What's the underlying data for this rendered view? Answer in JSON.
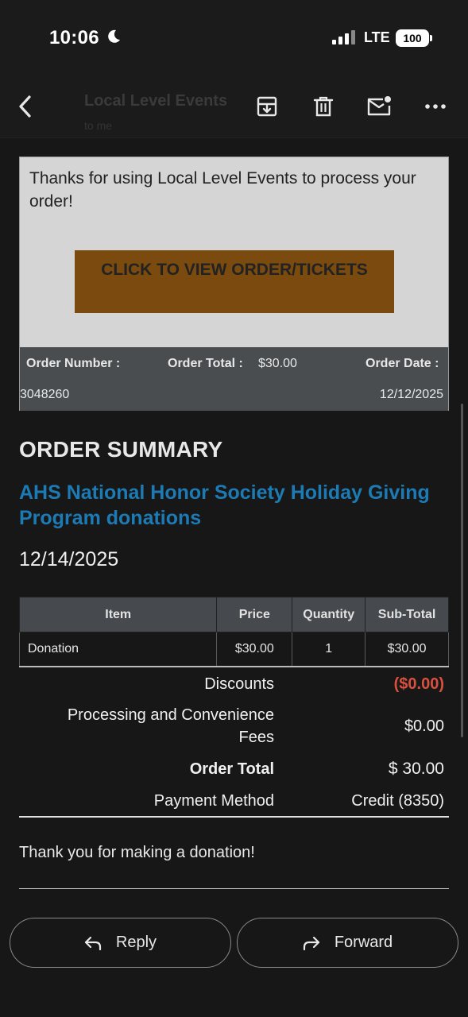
{
  "status_bar": {
    "time": "10:06",
    "network": "LTE",
    "battery": "100"
  },
  "toolbar": {
    "sender_faded": "Local Level Events",
    "recipient_faded": "to me"
  },
  "email": {
    "intro": "Thanks for using Local Level Events to process your order!",
    "cta_label": "CLICK TO VIEW ORDER/TICKETS",
    "order_number_label": "Order Number :",
    "order_number": "3048260",
    "order_total_label": "Order Total :",
    "order_total": "$30.00",
    "order_date_label": "Order Date :",
    "order_date": "12/12/2025",
    "summary_title": "ORDER SUMMARY",
    "event_title": "AHS National Honor Society Holiday Giving Program donations",
    "event_date": "12/14/2025",
    "table": {
      "headers": [
        "Item",
        "Price",
        "Quantity",
        "Sub-Total"
      ],
      "rows": [
        [
          "Donation",
          "$30.00",
          "1",
          "$30.00"
        ]
      ]
    },
    "totals": {
      "discounts_label": "Discounts",
      "discounts_value": "($0.00)",
      "fees_label": "Processing and Convenience Fees",
      "fees_value": "$0.00",
      "total_label": "Order Total",
      "total_value": "$ 30.00",
      "payment_label": "Payment Method",
      "payment_value": "Credit (8350)"
    },
    "thanks": "Thank you for making a donation!"
  },
  "actions": {
    "reply_label": "Reply",
    "forward_label": "Forward"
  },
  "colors": {
    "background": "#171717",
    "cta": "#7a4a0e",
    "event_title": "#1c7bb5",
    "negative": "#d9503f"
  }
}
